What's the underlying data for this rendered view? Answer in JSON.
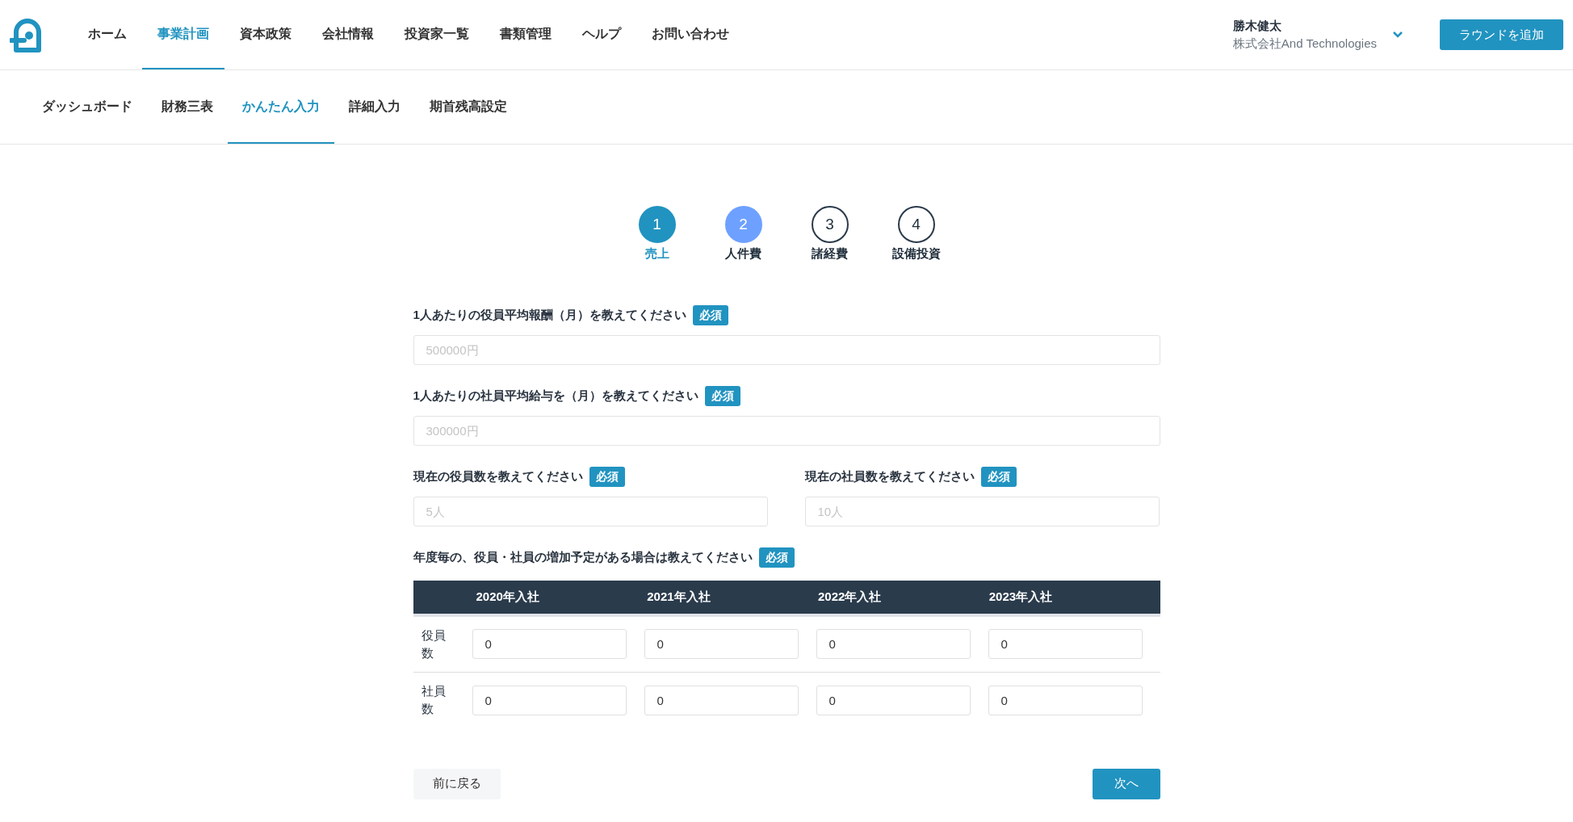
{
  "header": {
    "nav": [
      {
        "label": "ホーム",
        "selected": false
      },
      {
        "label": "事業計画",
        "selected": true
      },
      {
        "label": "資本政策",
        "selected": false
      },
      {
        "label": "会社情報",
        "selected": false
      },
      {
        "label": "投資家一覧",
        "selected": false
      },
      {
        "label": "書類管理",
        "selected": false
      },
      {
        "label": "ヘルプ",
        "selected": false
      },
      {
        "label": "お問い合わせ",
        "selected": false
      }
    ],
    "user": {
      "name": "勝木健太",
      "company": "株式会社And Technologies"
    },
    "add_button": "ラウンドを追加"
  },
  "subnav": [
    {
      "label": "ダッシュボード",
      "selected": false
    },
    {
      "label": "財務三表",
      "selected": false
    },
    {
      "label": "かんたん入力",
      "selected": true
    },
    {
      "label": "詳細入力",
      "selected": false
    },
    {
      "label": "期首残高設定",
      "selected": false
    }
  ],
  "steps": [
    {
      "number": "1",
      "label": "売上",
      "done": true,
      "selected": false
    },
    {
      "number": "2",
      "label": "人件費",
      "done": false,
      "selected": true
    },
    {
      "number": "3",
      "label": "諸経費",
      "done": false,
      "selected": false
    },
    {
      "number": "4",
      "label": "設備投資",
      "done": false,
      "selected": false
    }
  ],
  "fields": [
    {
      "label": "1人あたりの役員平均報酬（月）を教えてください",
      "badge": "必須",
      "placeholder": "500000円",
      "half": false
    },
    {
      "label": "1人あたりの社員平均給与を（月）を教えてください",
      "badge": "必須",
      "placeholder": "300000円",
      "half": false
    },
    {
      "label": "現在の役員数を教えてください",
      "badge": "必須",
      "placeholder": "5人",
      "half": true
    },
    {
      "label": "現在の社員数を教えてください",
      "badge": "必須",
      "placeholder": "10人",
      "half": true
    }
  ],
  "plan": {
    "label": "年度毎の、役員・社員の増加予定がある場合は教えてください",
    "badge": "必須",
    "table": {
      "columns": [
        "2020年入社",
        "2021年入社",
        "2022年入社",
        "2023年入社"
      ],
      "rows": [
        {
          "label": "役員数",
          "values": [
            "0",
            "0",
            "0",
            "0"
          ]
        },
        {
          "label": "社員数",
          "values": [
            "0",
            "0",
            "0",
            "0"
          ]
        }
      ]
    }
  },
  "footer": {
    "back": "前に戻る",
    "next": "次へ"
  }
}
